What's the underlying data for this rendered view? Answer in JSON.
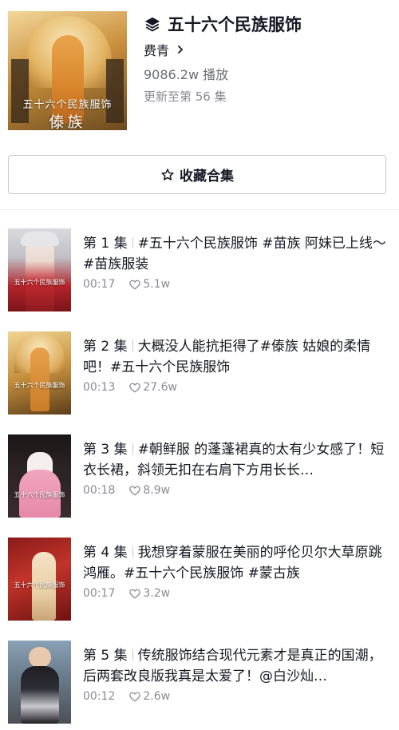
{
  "collection": {
    "title": "五十六个民族服饰",
    "author": "费青",
    "plays": "9086.2w 播放",
    "update_status": "更新至第 56 集",
    "cover_caption_line1": "五十六个民族服饰",
    "cover_caption_line2": "傣族"
  },
  "actions": {
    "collect_label": "收藏合集"
  },
  "episodes": [
    {
      "number": "第 1 集",
      "title": "#五十六个民族服饰 #苗族 阿妹已上线～#苗族服装",
      "duration": "00:17",
      "likes": "5.1w",
      "thumb_caption": "五十六个民族服饰"
    },
    {
      "number": "第 2 集",
      "title": "大概没人能抗拒得了#傣族 姑娘的柔情吧！#五十六个民族服饰",
      "duration": "00:13",
      "likes": "27.6w",
      "thumb_caption": "五十六个民族服饰"
    },
    {
      "number": "第 3 集",
      "title": "#朝鲜服 的蓬蓬裙真的太有少女感了！短衣长裙，斜领无扣在右肩下方用长长…",
      "duration": "00:18",
      "likes": "8.9w",
      "thumb_caption": "五十六个民族服饰"
    },
    {
      "number": "第 4 集",
      "title": "我想穿着蒙服在美丽的呼伦贝尔大草原跳鸿雁。#五十六个民族服饰 #蒙古族",
      "duration": "00:17",
      "likes": "3.2w",
      "thumb_caption": "五十六个民族服饰"
    },
    {
      "number": "第 5 集",
      "title": "传统服饰结合现代元素才是真正的国潮，后两套改良版我真是太爱了！@白沙灿…",
      "duration": "00:12",
      "likes": "2.6w",
      "thumb_caption": ""
    }
  ],
  "icons": {
    "collection": "layers-icon",
    "author_arrow": "chevron-right-icon",
    "collect": "star-outline-icon",
    "like": "heart-outline-icon"
  },
  "colors": {
    "primary_text": "#161823",
    "secondary_text": "#8a8b91",
    "border": "#c8c9cc"
  }
}
